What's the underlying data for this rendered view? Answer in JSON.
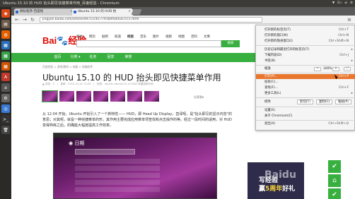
{
  "window": {
    "title": "Ubuntu 15.10 的 HUD 抬头即见快捷菜单作用_百度经验 - Chromium",
    "status": [
      "▼",
      "En",
      "◂)",
      "⚙"
    ]
  },
  "launcher": [
    {
      "icon": "ubuntu-logo-icon",
      "glyph": "◉",
      "color": "#dd4814"
    },
    {
      "icon": "files-icon",
      "glyph": "▤",
      "color": "#6d5b4b"
    },
    {
      "icon": "firefox-icon",
      "glyph": "◍",
      "color": "#e66000"
    },
    {
      "icon": "libreoffice-writer-icon",
      "glyph": "▦",
      "color": "#2a6fba"
    },
    {
      "icon": "libreoffice-calc-icon",
      "glyph": "▦",
      "color": "#37a44a"
    },
    {
      "icon": "libreoffice-impress-icon",
      "glyph": "▦",
      "color": "#d35400"
    },
    {
      "icon": "software-center-icon",
      "glyph": "A",
      "color": "#c0392b"
    },
    {
      "icon": "amazon-icon",
      "glyph": "a",
      "color": "#555"
    },
    {
      "icon": "settings-icon",
      "glyph": "⚙",
      "color": "#666"
    },
    {
      "icon": "chromium-icon",
      "glyph": "◎",
      "color": "#3a7bd5"
    },
    {
      "icon": "terminal-icon",
      "glyph": ">_",
      "color": "#333"
    },
    {
      "icon": "trash-icon",
      "glyph": "🗑",
      "color": "#444"
    }
  ],
  "tabs": [
    {
      "label": "目标程序-百度经",
      "close": "×"
    },
    {
      "label": "Ubuntu 15.10 的 HUD 抬",
      "close": "×"
    }
  ],
  "toolbar": {
    "back": "←",
    "forward": "→",
    "reload": "↻",
    "url": "jingyan.baidu.com/article/49711c617791b0fa441b7cc1.html",
    "menu_icon": "≡"
  },
  "page": {
    "logo_bai": "Bai",
    "logo_paw": "🐾",
    "logo_tail": "经验",
    "topnav": [
      "新闻",
      "网页",
      "贴吧",
      "知道",
      "经验",
      "音乐",
      "图片",
      "视频",
      "地图",
      "百科",
      "文库"
    ],
    "search_button": "搜索",
    "greennav": [
      "首页",
      "分类 ▾",
      "任务",
      "回享",
      "荣誉",
      "",
      "",
      ""
    ],
    "breadcrumb": "百度经验 > 游戏/数码 > 电脑 > 电脑软件",
    "title": "Ubuntu 15.10 的 HUD 抬头即见快捷菜单作用",
    "meta": "▲ 浏览：5　|　更新：2015-10-22 15:09　|　标签：ubuntu  ubuntu15.10 HUD 快捷菜单作用",
    "share": "分享到▾",
    "paragraph": "从 12.04 开始，Ubuntu 开始引入了一个新特性—— HUD，即 Head Up Display，直译呢，是\"抬头即见的显示内容\"的意思；对其呢，就是一种快捷菜单的形，其作用主要完成应用菜单项查找和点击操作的等。经过一段时间的适用，对 HUD 变得熟练之后，的确能大幅度提高工作效率。",
    "screenshot_date": "◉ 日期",
    "ad_line1": "写经验",
    "ad_line2_a": "赢",
    "ad_line2_b": "5周年",
    "ad_line2_c": "好礼",
    "ad_watermark": "Baidu"
  },
  "menu": {
    "new_tab": "打开新的标签页(T)",
    "new_tab_sc": "Ctrl+T",
    "new_window": "打开新的窗口(N)",
    "new_window_sc": "Ctrl+N",
    "incognito": "打开新的隐身窗口(I)",
    "incognito_sc": "Ctrl+Shift+N",
    "history": "历史记录和最近打开的标签页(T)",
    "downloads": "下载内容(D)",
    "downloads_sc": "Ctrl+J",
    "bookmarks": "书签(B)",
    "zoom_label": "缩放",
    "zoom_minus": "−",
    "zoom_value": "100%",
    "zoom_plus": "+",
    "fullscreen": "⛶",
    "print": "打印(P)...",
    "print_sc": "Ctrl+P",
    "cast": "投射(C)...",
    "find": "查找(F)...",
    "find_sc": "Ctrl+F",
    "more_tools": "更多工具(L)",
    "edit_label": "修改",
    "cut": "剪切(T)",
    "copy": "复制(C)",
    "paste": "粘贴(P)",
    "settings": "设置(S)",
    "about": "关于 Chromium(C)",
    "exit": "退出(X)",
    "exit_sc": "Ctrl+Shift+Q",
    "arrow": "▸"
  },
  "colors": {
    "accent": "#38b03f",
    "menu_highlight": "#e8762d",
    "baidu_red": "#e10601"
  }
}
